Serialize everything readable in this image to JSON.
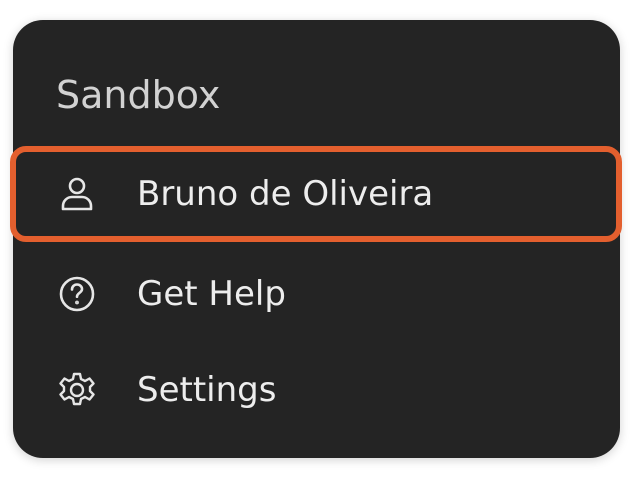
{
  "menu": {
    "header": "Sandbox",
    "items": [
      {
        "label": "Bruno de Oliveira",
        "icon": "user-icon"
      },
      {
        "label": "Get Help",
        "icon": "help-circle-icon"
      },
      {
        "label": "Settings",
        "icon": "gear-icon"
      }
    ]
  },
  "colors": {
    "menu_background": "#242424",
    "text": "#ededed",
    "highlight": "#e35f2e"
  }
}
